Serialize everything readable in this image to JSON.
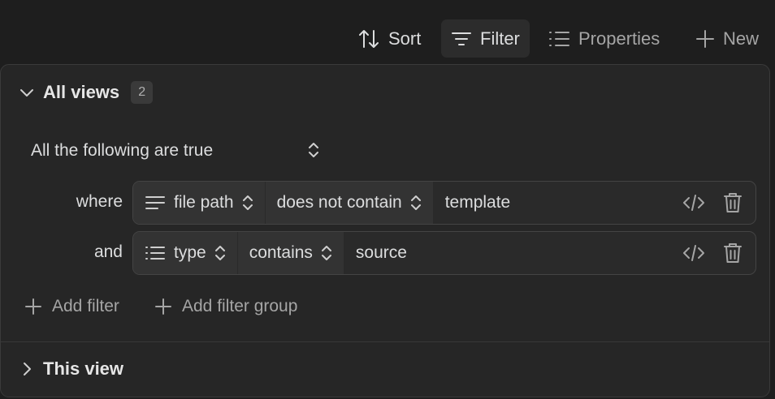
{
  "toolbar": {
    "sort_label": "Sort",
    "filter_label": "Filter",
    "properties_label": "Properties",
    "new_label": "New"
  },
  "all_views": {
    "title": "All views",
    "count": "2",
    "conjunction": "All the following are true",
    "filters": [
      {
        "prefix": "where",
        "property": "file path",
        "property_icon": "text-lines-icon",
        "operator": "does not contain",
        "value": "template"
      },
      {
        "prefix": "and",
        "property": "type",
        "property_icon": "list-icon",
        "operator": "contains",
        "value": "source"
      }
    ],
    "add_filter_label": "Add filter",
    "add_filter_group_label": "Add filter group"
  },
  "this_view": {
    "title": "This view"
  },
  "colors": {
    "background": "#1e1e1e",
    "panel": "#262626",
    "segment": "#333333",
    "text": "#dcddde",
    "muted": "#a5a5a5"
  }
}
